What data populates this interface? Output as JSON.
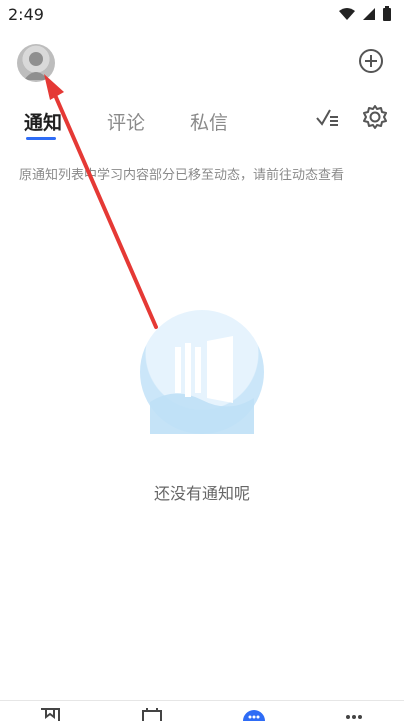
{
  "status_bar": {
    "time": "2:49"
  },
  "header": {
    "avatar_icon": "user-avatar-icon",
    "add_icon": "plus-circle-icon"
  },
  "tabs": [
    {
      "label": "通知",
      "active": true
    },
    {
      "label": "评论",
      "active": false
    },
    {
      "label": "私信",
      "active": false
    }
  ],
  "tab_tools": {
    "mark_read_icon": "checklist-icon",
    "settings_icon": "gear-icon"
  },
  "notice": {
    "text": "原通知列表中学习内容部分已移至动态，请前往动态查看"
  },
  "empty_state": {
    "message": "还没有通知呢"
  },
  "colors": {
    "accent": "#2e6cf6",
    "arrow": "#e53935"
  }
}
